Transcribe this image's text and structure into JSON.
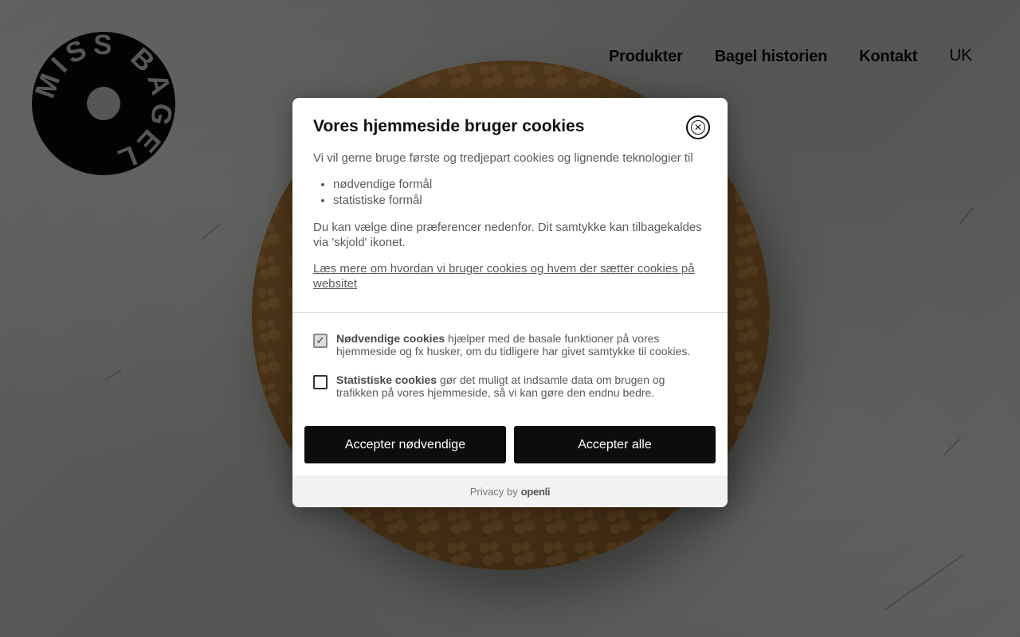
{
  "nav": {
    "items": [
      {
        "label": "Produkter"
      },
      {
        "label": "Bagel historien"
      },
      {
        "label": "Kontakt"
      }
    ],
    "language": "UK"
  },
  "logo": {
    "text": "MISS BAGEL"
  },
  "cookie_dialog": {
    "title": "Vores hjemmeside bruger cookies",
    "intro": "Vi vil gerne bruge første og tredjepart cookies og lignende teknologier til",
    "purposes": [
      "nødvendige formål",
      "statistiske formål"
    ],
    "preferences_text": "Du kan vælge dine præferencer nedenfor. Dit samtykke kan tilbagekaldes via 'skjold' ikonet.",
    "more_link": "Læs mere om hvordan vi bruger cookies og hvem der sætter cookies på websitet",
    "options": [
      {
        "title": "Nødvendige cookies",
        "description": " hjælper med de basale funktioner på vores hjemmeside og fx husker, om du tidligere har givet samtykke til cookies.",
        "checked": true,
        "disabled": true
      },
      {
        "title": "Statistiske cookies",
        "description": " gør det muligt at indsamle data om brugen og trafikken på vores hjemmeside, så vi kan gøre den endnu bedre.",
        "checked": false,
        "disabled": false
      }
    ],
    "accept_necessary_label": "Accepter nødvendige",
    "accept_all_label": "Accepter alle",
    "footer_prefix": "Privacy by",
    "footer_brand": "openli"
  },
  "icons": {
    "close": "close-circle-icon",
    "checkmark": "check-icon"
  }
}
